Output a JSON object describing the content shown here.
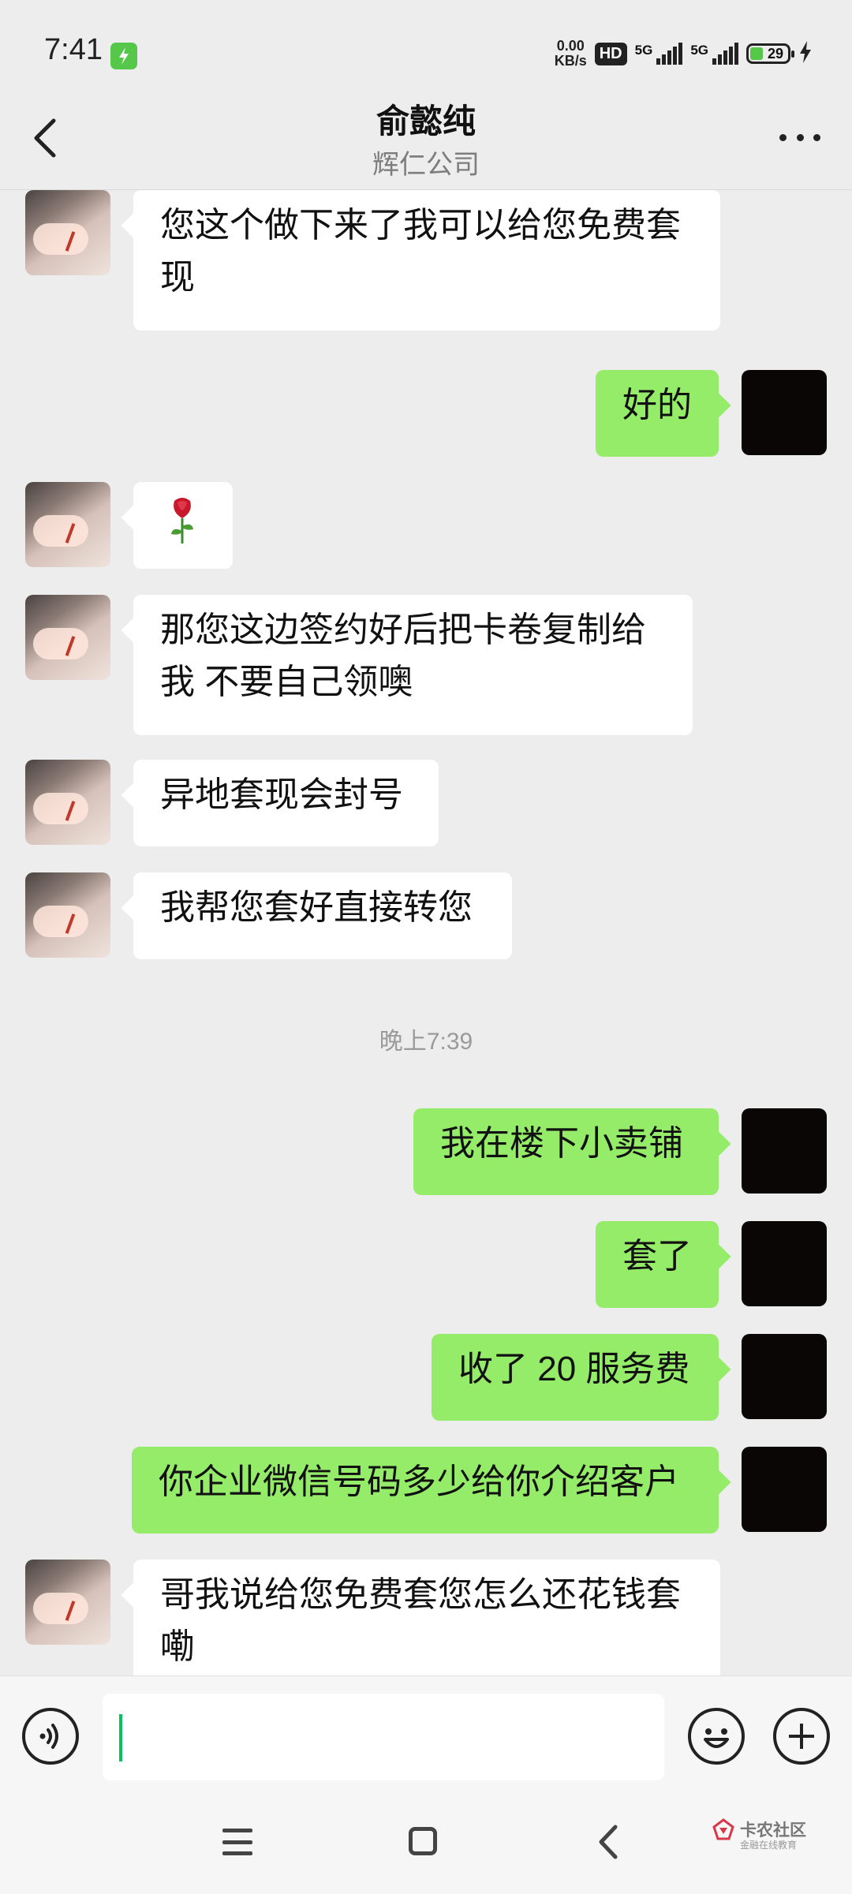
{
  "status_bar": {
    "time": "7:41",
    "speed_value": "0.00",
    "speed_unit": "KB/s",
    "hd_label": "HD",
    "network1": "5G",
    "network2": "5G",
    "battery_level": "29"
  },
  "header": {
    "title": "俞懿纯",
    "subtitle": "辉仁公司"
  },
  "messages": [
    {
      "from": "them",
      "text": "您这个做下来了我可以给您免费套现"
    },
    {
      "from": "me",
      "text": "好的"
    },
    {
      "from": "them",
      "text": "",
      "sticker": "rose"
    },
    {
      "from": "them",
      "text": "那您这边签约好后把卡卷复制给我 不要自己领噢"
    },
    {
      "from": "them",
      "text": "异地套现会封号"
    },
    {
      "from": "them",
      "text": "我帮您套好直接转您"
    },
    {
      "timestamp": "晚上7:39"
    },
    {
      "from": "me",
      "text": "我在楼下小卖铺"
    },
    {
      "from": "me",
      "text": "套了"
    },
    {
      "from": "me",
      "text": "收了 20 服务费"
    },
    {
      "from": "me",
      "text": "你企业微信号码多少给你介绍客户"
    },
    {
      "from": "them",
      "text": "哥我说给您免费套您怎么还花钱套嘞"
    }
  ],
  "input": {
    "value": "",
    "placeholder": ""
  },
  "watermark": {
    "name": "卡农社区",
    "tagline": "金融在线教育"
  },
  "colors": {
    "background": "#ededed",
    "my_bubble": "#95ec69",
    "their_bubble": "#ffffff",
    "accent": "#07c160"
  }
}
